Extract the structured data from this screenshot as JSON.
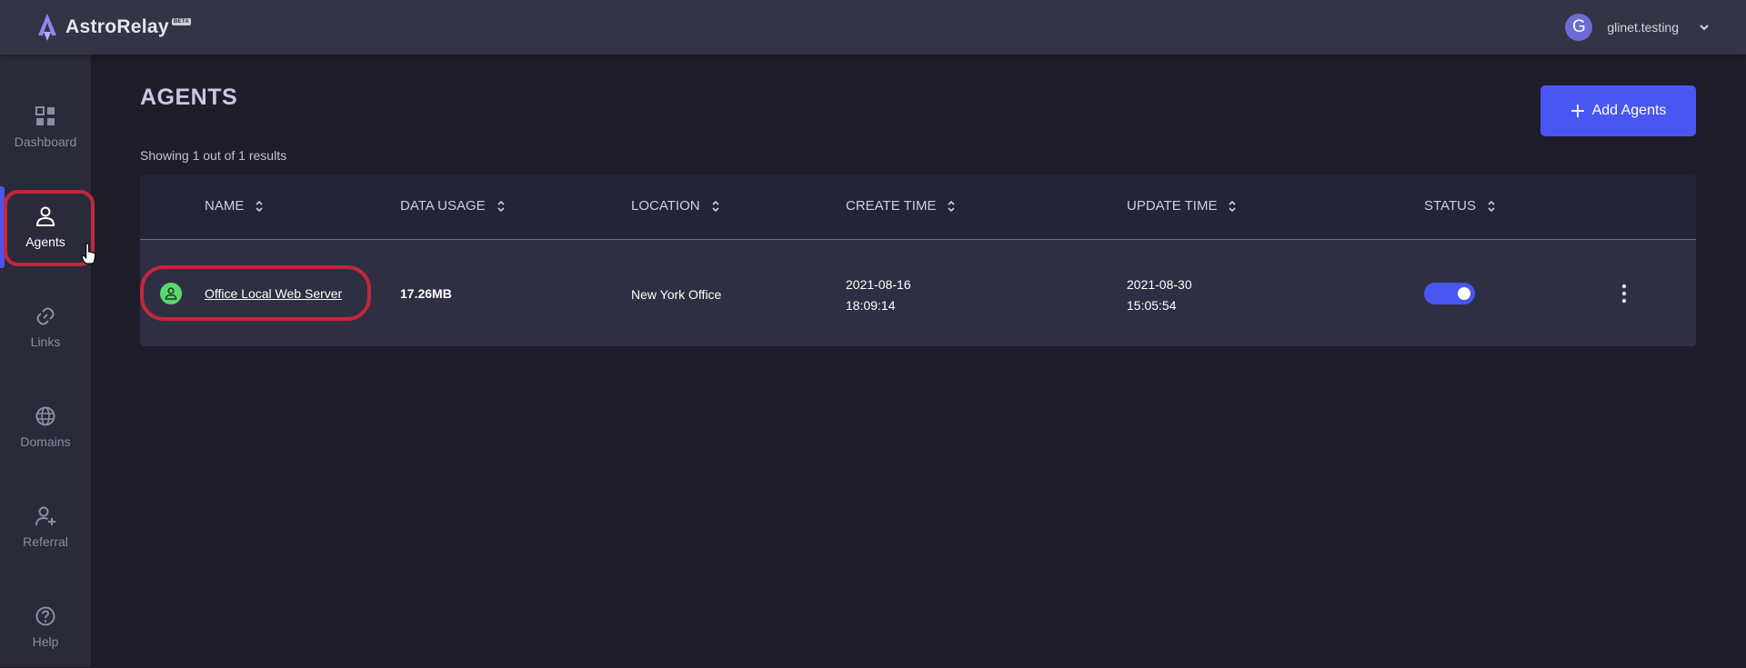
{
  "app": {
    "name": "AstroRelay",
    "badge": "BETA"
  },
  "user": {
    "initial": "G",
    "name": "glinet.testing"
  },
  "sidebar": {
    "items": [
      {
        "label": "Dashboard",
        "icon": "dashboard-icon",
        "active": false
      },
      {
        "label": "Agents",
        "icon": "agent-person-icon",
        "active": true
      },
      {
        "label": "Links",
        "icon": "link-icon",
        "active": false
      },
      {
        "label": "Domains",
        "icon": "globe-icon",
        "active": false
      },
      {
        "label": "Referral",
        "icon": "add-person-icon",
        "active": false
      },
      {
        "label": "Help",
        "icon": "help-icon",
        "active": false
      }
    ]
  },
  "page": {
    "title": "AGENTS",
    "results_text": "Showing 1 out of 1 results",
    "add_button_label": "Add Agents"
  },
  "table": {
    "columns": [
      "NAME",
      "DATA USAGE",
      "LOCATION",
      "CREATE TIME",
      "UPDATE TIME",
      "STATUS"
    ],
    "rows": [
      {
        "name": "Office Local Web Server",
        "data_usage": "17.26MB",
        "location": "New York Office",
        "create_date": "2021-08-16",
        "create_time": "18:09:14",
        "update_date": "2021-08-30",
        "update_time": "15:05:54",
        "enabled": true
      }
    ]
  },
  "colors": {
    "background": "#1e1d29",
    "topbar": "#333446",
    "sidebar": "#2a2a3a",
    "accent": "#4a56f2",
    "online": "#59d86c",
    "highlight": "#c0283c"
  }
}
